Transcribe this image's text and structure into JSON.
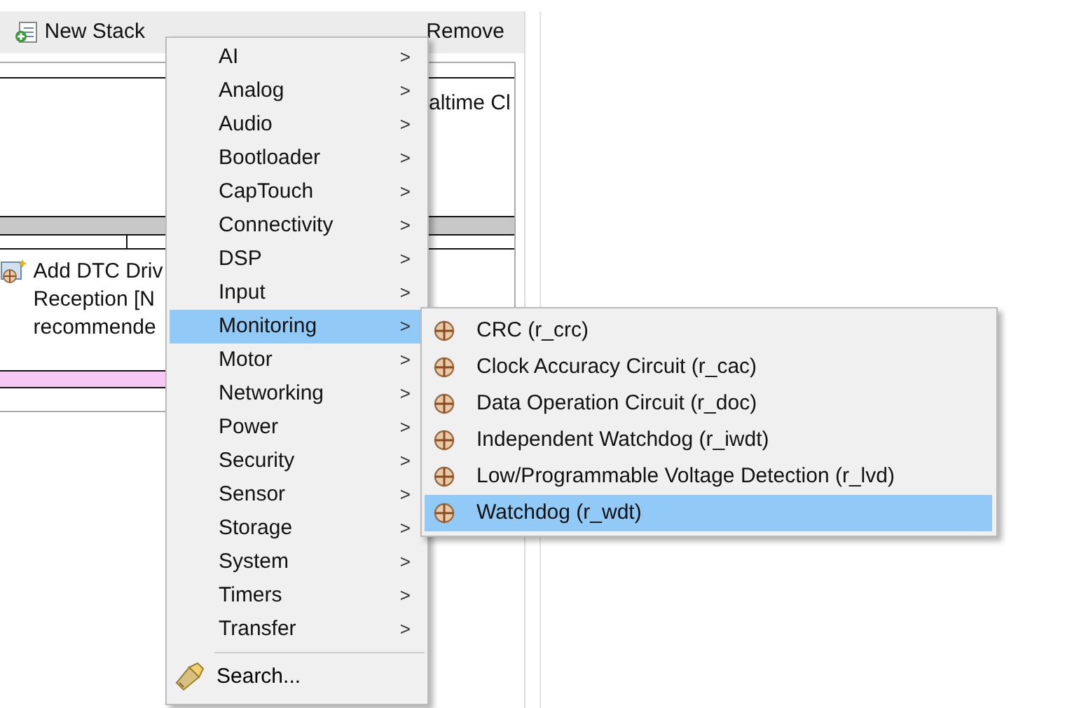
{
  "toolbar": {
    "new_stack": "New Stack",
    "remove": "Remove"
  },
  "stack_panel": {
    "partial_label": "altime Cl"
  },
  "description": {
    "lines": [
      "Add DTC Driv",
      "Reception [N",
      "recommende"
    ]
  },
  "context_menu": {
    "items": [
      {
        "label": "AI",
        "submenu": true,
        "selected": false
      },
      {
        "label": "Analog",
        "submenu": true,
        "selected": false
      },
      {
        "label": "Audio",
        "submenu": true,
        "selected": false
      },
      {
        "label": "Bootloader",
        "submenu": true,
        "selected": false
      },
      {
        "label": "CapTouch",
        "submenu": true,
        "selected": false
      },
      {
        "label": "Connectivity",
        "submenu": true,
        "selected": false
      },
      {
        "label": "DSP",
        "submenu": true,
        "selected": false
      },
      {
        "label": "Input",
        "submenu": true,
        "selected": false
      },
      {
        "label": "Monitoring",
        "submenu": true,
        "selected": true
      },
      {
        "label": "Motor",
        "submenu": true,
        "selected": false
      },
      {
        "label": "Networking",
        "submenu": true,
        "selected": false
      },
      {
        "label": "Power",
        "submenu": true,
        "selected": false
      },
      {
        "label": "Security",
        "submenu": true,
        "selected": false
      },
      {
        "label": "Sensor",
        "submenu": true,
        "selected": false
      },
      {
        "label": "Storage",
        "submenu": true,
        "selected": false
      },
      {
        "label": "System",
        "submenu": true,
        "selected": false
      },
      {
        "label": "Timers",
        "submenu": true,
        "selected": false
      },
      {
        "label": "Transfer",
        "submenu": true,
        "selected": false
      }
    ],
    "chevron": ">",
    "search": "Search..."
  },
  "submenu": {
    "items": [
      {
        "label": "CRC (r_crc)",
        "selected": false
      },
      {
        "label": "Clock Accuracy Circuit (r_cac)",
        "selected": false
      },
      {
        "label": "Data Operation Circuit (r_doc)",
        "selected": false
      },
      {
        "label": "Independent Watchdog (r_iwdt)",
        "selected": false
      },
      {
        "label": "Low/Programmable Voltage Detection (r_lvd)",
        "selected": false
      },
      {
        "label": "Watchdog (r_wdt)",
        "selected": true
      }
    ]
  }
}
